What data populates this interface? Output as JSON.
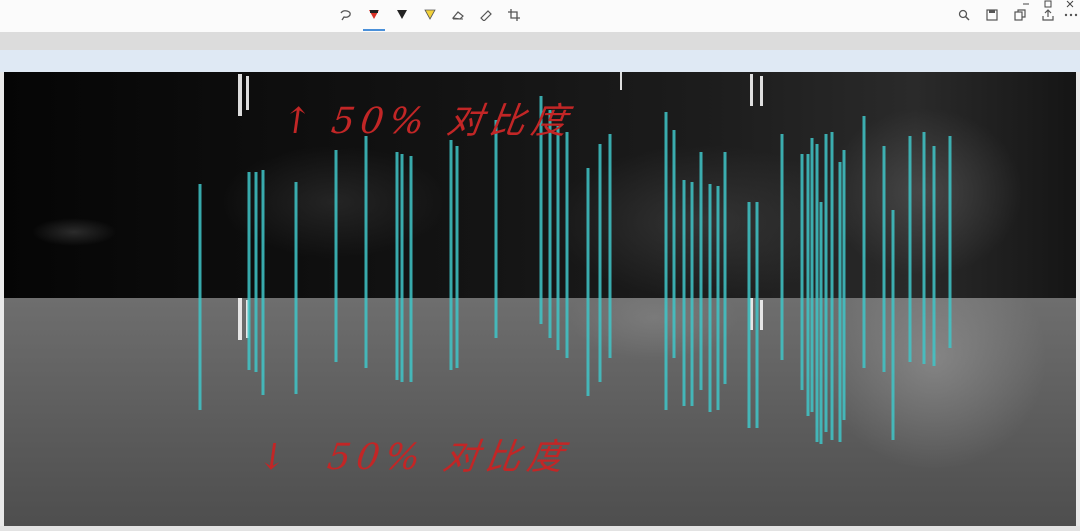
{
  "toolbar": {
    "tools": [
      {
        "icon": "lasso-select-icon",
        "active": false
      },
      {
        "icon": "pen-red-icon",
        "active": true,
        "color": "#d93025"
      },
      {
        "icon": "pen-black-icon",
        "active": false,
        "color": "#222222"
      },
      {
        "icon": "highlighter-yellow-icon",
        "active": false,
        "color": "#f2d13a"
      },
      {
        "icon": "eraser-icon",
        "active": false
      },
      {
        "icon": "ruler-icon",
        "active": false
      },
      {
        "icon": "crop-icon",
        "active": false
      }
    ],
    "right_icons": [
      "zoom-icon",
      "save-icon",
      "copy-icon",
      "share-icon",
      "more-icon"
    ],
    "window_controls": [
      "minimize-icon",
      "maximize-icon",
      "close-icon"
    ]
  },
  "colors": {
    "annotation": "#c22626",
    "cyan_lines": "#3fc6c8",
    "toolbar_bg": "#fbfbfb",
    "band_blue": "#dfe9f4"
  },
  "annotations": {
    "top": {
      "arrow": "↑",
      "text": "50% 对比度"
    },
    "bottom": {
      "arrow": "↓",
      "text": "50% 对比度"
    }
  },
  "image": {
    "upper_region": "black",
    "lower_region": "gray"
  }
}
